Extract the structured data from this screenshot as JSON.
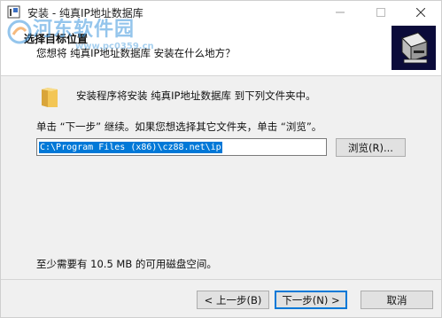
{
  "window": {
    "title": "安装 - 纯真IP地址数据库",
    "icons": {
      "app": "installer-app-icon",
      "minimize": "minimize-icon",
      "maximize": "maximize-icon",
      "close": "close-icon"
    }
  },
  "header": {
    "title": "选择目标位置",
    "subtitle": "您想将 纯真IP地址数据库 安装在什么地方？",
    "icon": "setup-computer-icon"
  },
  "watermark": {
    "text": "河东软件园",
    "url": "www.pc0359.cn"
  },
  "body": {
    "folder_icon": "folder-icon",
    "info": "安装程序将安装 纯真IP地址数据库 到下列文件夹中。",
    "instruction": "单击 “下一步” 继续。如果您想选择其它文件夹，单击 “浏览”。",
    "path_value": "C:\\Program Files (x86)\\cz88.net\\ip",
    "browse_label": "浏览(R)...",
    "space_required": "至少需要有 10.5 MB 的可用磁盘空间。"
  },
  "footer": {
    "back_label": "< 上一步(B)",
    "next_label": "下一步(N) >",
    "cancel_label": "取消"
  },
  "colors": {
    "accent": "#0078d7",
    "selection": "#0078d7",
    "header_bg": "#ffffff",
    "body_bg": "#f0f0f0"
  }
}
